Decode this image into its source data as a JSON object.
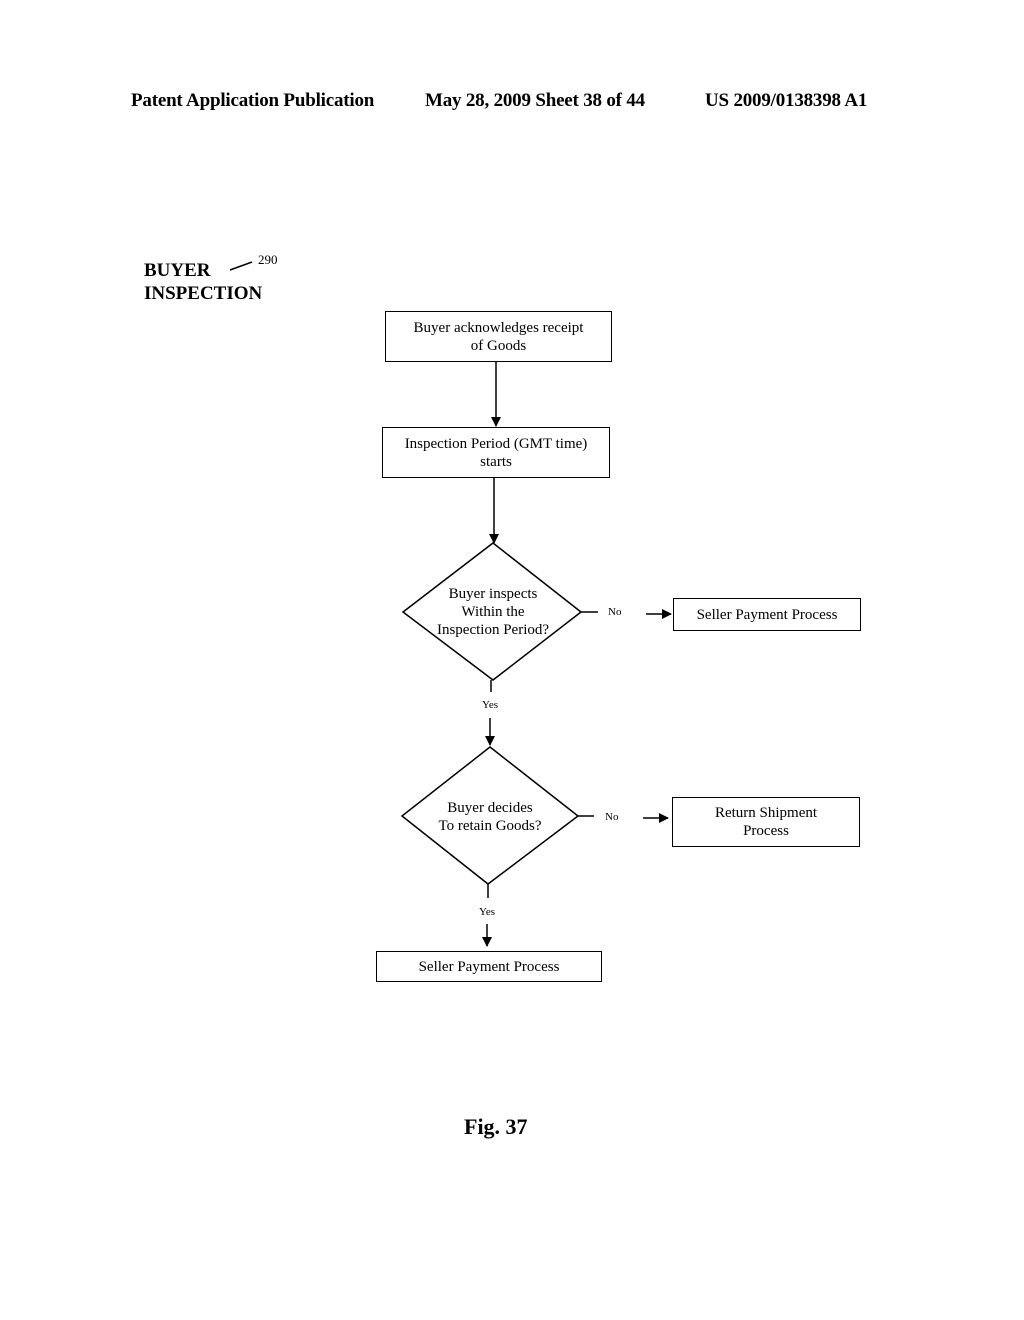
{
  "header": {
    "publication": "Patent Application Publication",
    "date_sheet": "May 28, 2009  Sheet 38 of 44",
    "patent_number": "US 2009/0138398 A1"
  },
  "diagram": {
    "title_line1": "BUYER",
    "title_line2": "INSPECTION",
    "reference_number": "290",
    "nodes": {
      "ack_receipt": {
        "line1": "Buyer acknowledges receipt",
        "line2": "of Goods"
      },
      "inspection_start": {
        "line1": "Inspection Period (GMT time)",
        "line2": "starts"
      },
      "decision_inspect": {
        "line1": "Buyer inspects",
        "line2": "Within the",
        "line3": "Inspection Period?"
      },
      "seller_payment_1": {
        "label": "Seller Payment Process"
      },
      "decision_retain": {
        "line1": "Buyer decides",
        "line2": "To retain Goods?"
      },
      "return_shipment": {
        "line1": "Return Shipment",
        "line2": "Process"
      },
      "seller_payment_2": {
        "label": "Seller Payment Process"
      }
    },
    "edges": {
      "no_1": "No",
      "yes_1": "Yes",
      "no_2": "No",
      "yes_2": "Yes"
    },
    "figure_label": "Fig. 37"
  }
}
